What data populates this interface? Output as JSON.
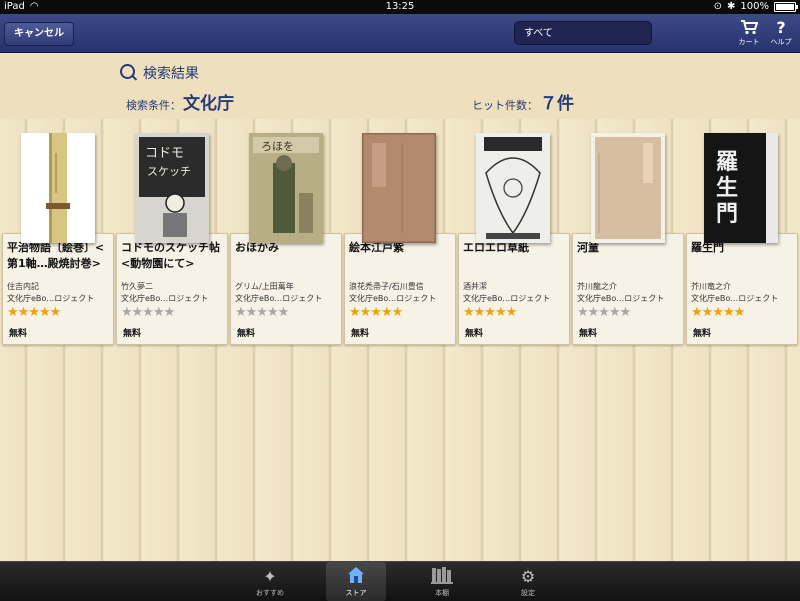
{
  "status_bar": {
    "device": "iPad",
    "time": "13:25",
    "battery": "100%",
    "battery_level": 1.0
  },
  "nav": {
    "cancel_label": "キャンセル",
    "filter_value": "すべて",
    "cart_label": "カート",
    "help_label": "ヘルプ"
  },
  "header": {
    "title": "検索結果",
    "condition_label": "検索条件：",
    "condition_value": "文化庁",
    "hits_label": "ヒット件数：",
    "hits_value": "７件"
  },
  "books": [
    {
      "title": "平治物語〔絵巻〕<第1軸…殿焼討巻>",
      "author": "住吉内記",
      "publisher": "文化庁eBo…ロジェクト",
      "rating": 5,
      "price": "無料"
    },
    {
      "title": "コドモのスケッチ帖 <動物園にて>",
      "author": "竹久夢二",
      "publisher": "文化庁eBo…ロジェクト",
      "rating": 0,
      "price": "無料"
    },
    {
      "title": "おほかみ",
      "author": "グリム/上田萬年",
      "publisher": "文化庁eBo…ロジェクト",
      "rating": 0,
      "price": "無料"
    },
    {
      "title": "絵本江戸紫",
      "author": "浪花禿帚子/石川豊信",
      "publisher": "文化庁eBo…ロジェクト",
      "rating": 5,
      "price": "無料"
    },
    {
      "title": "エロエロ草紙",
      "author": "酒井潔",
      "publisher": "文化庁eBo…ロジェクト",
      "rating": 5,
      "price": "無料"
    },
    {
      "title": "河童",
      "author": "芥川龍之介",
      "publisher": "文化庁eBo…ロジェクト",
      "rating": 0,
      "price": "無料"
    },
    {
      "title": "羅生門",
      "author": "芥川竜之介",
      "publisher": "文化庁eBo…ロジェクト",
      "rating": 5,
      "price": "無料"
    }
  ],
  "covers": [
    {
      "text": "",
      "bg": "#d9c58a"
    },
    {
      "text": "コドモのスケッチ帖",
      "bg": "#d0cfc8"
    },
    {
      "text": "おほかみ",
      "bg": "#b9b08a"
    },
    {
      "text": "",
      "bg": "#b88c72"
    },
    {
      "text": "",
      "bg": "#ecebea"
    },
    {
      "text": "",
      "bg": "#d9c0a3"
    },
    {
      "text": "羅生門",
      "bg": "#1a1a1a"
    }
  ],
  "tabs": [
    {
      "label": "おすすめ",
      "icon": "sparkle-icon"
    },
    {
      "label": "ストア",
      "icon": "store-icon"
    },
    {
      "label": "本棚",
      "icon": "bookshelf-icon"
    },
    {
      "label": "設定",
      "icon": "gear-icon"
    }
  ],
  "colors": {
    "nav": "#2f3b74",
    "accent_text": "#263a7a",
    "star": "#f2a100"
  }
}
